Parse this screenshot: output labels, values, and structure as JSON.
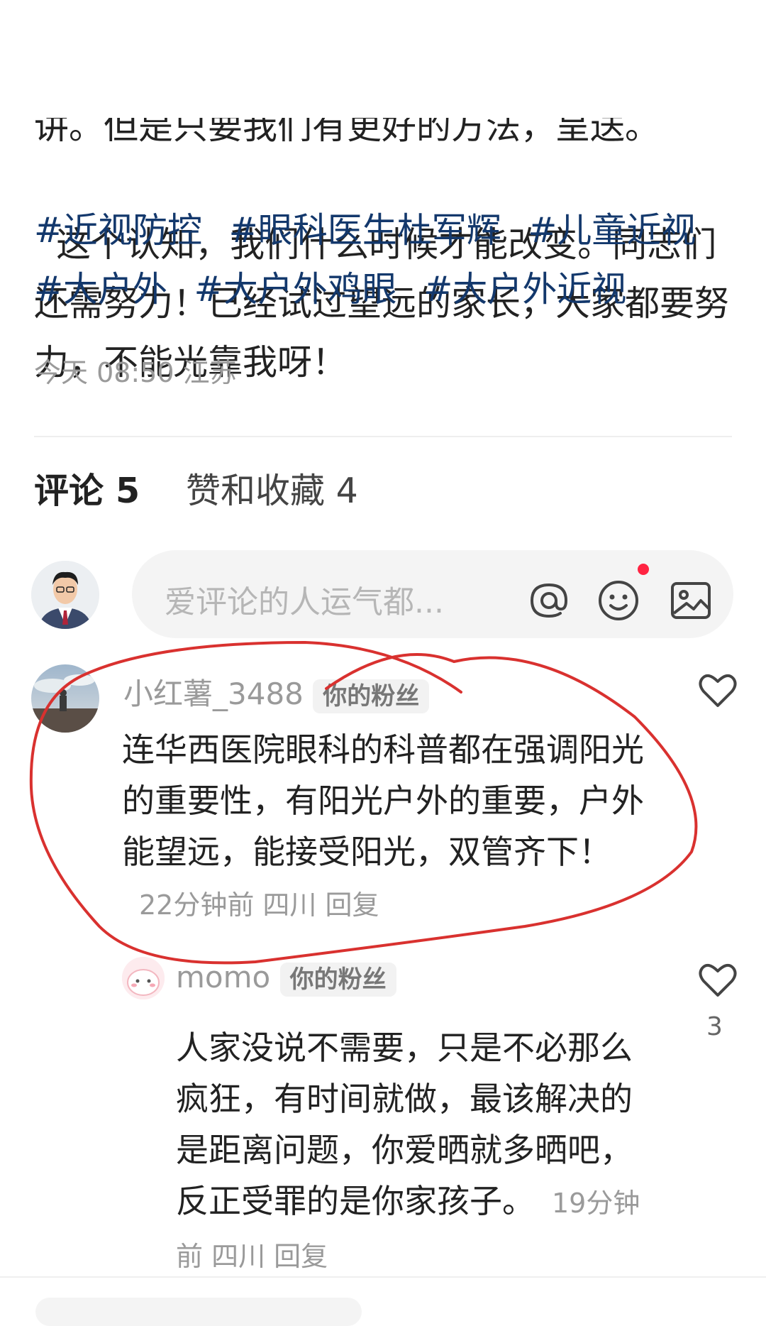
{
  "post": {
    "text_top_clipped": "讲。但是只要我们有更好的方法，呈送。",
    "text_body": "这个认知，我们什么时候才能改变。同志们还需努力！已经试过望远的家长，大家都要努力，不能光靠我呀！",
    "tags": [
      "#近视防控",
      "#眼科医生杜军辉",
      "#儿童近视",
      "#大户外",
      "#大户外鸡眼",
      "#大户外近视"
    ],
    "time_location": "今天 08:50 江苏"
  },
  "tabs": {
    "comments": "评论 5",
    "likes": "赞和收藏 4"
  },
  "comment_input": {
    "placeholder": "爱评论的人运气都..."
  },
  "comments": [
    {
      "username": "小红薯_3488",
      "badge": "你的粉丝",
      "text": "连华西医院眼科的科普都在强调阳光的重要性，有阳光户外的重要，户外能望远，能接受阳光，双管齐下！",
      "meta": "22分钟前  四川 回复"
    },
    {
      "username": "momo",
      "badge": "你的粉丝",
      "text": "人家没说不需要，只是不必那么疯狂，有时间就做，最该解决的是距离问题，你爱晒就多晒吧，反正受罪的是你家孩子。",
      "meta": "19分钟前  四川 回复",
      "likes": "3"
    }
  ],
  "colors": {
    "tag": "#13386c",
    "annotation": "#d9312f",
    "notify_dot": "#ff2442"
  }
}
